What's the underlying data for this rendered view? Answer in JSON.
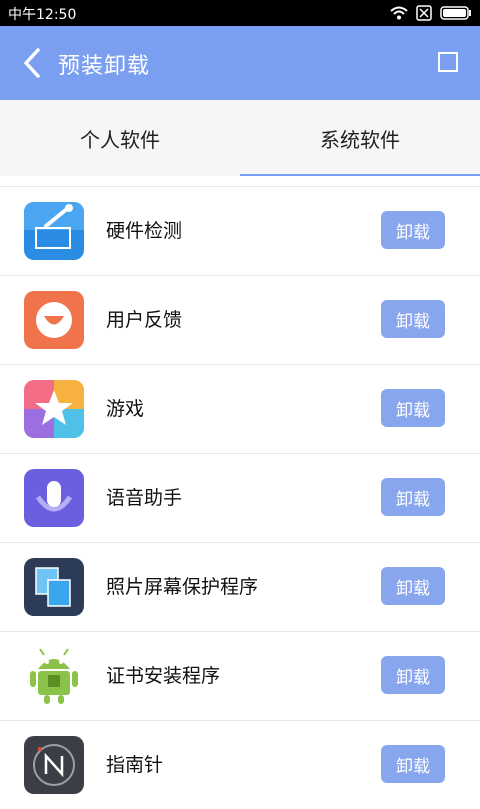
{
  "status_bar": {
    "time": "中午12:50"
  },
  "app_bar": {
    "title": "预装卸载"
  },
  "tabs": [
    {
      "label": "个人软件",
      "selected": false
    },
    {
      "label": "系统软件",
      "selected": true
    }
  ],
  "apps": [
    {
      "name": "硬件检测",
      "icon": "hardware-test-icon",
      "action": "卸载"
    },
    {
      "name": "用户反馈",
      "icon": "feedback-smile-icon",
      "action": "卸载"
    },
    {
      "name": "游戏",
      "icon": "game-star-icon",
      "action": "卸载"
    },
    {
      "name": "语音助手",
      "icon": "voice-assistant-icon",
      "action": "卸载"
    },
    {
      "name": "照片屏幕保护程序",
      "icon": "photo-screensaver-icon",
      "action": "卸载"
    },
    {
      "name": "证书安装程序",
      "icon": "android-certificate-icon",
      "action": "卸载"
    },
    {
      "name": "指南针",
      "icon": "compass-icon",
      "action": "卸载"
    }
  ],
  "colors": {
    "accent": "#7b9ff0",
    "button": "#88a6ee"
  }
}
